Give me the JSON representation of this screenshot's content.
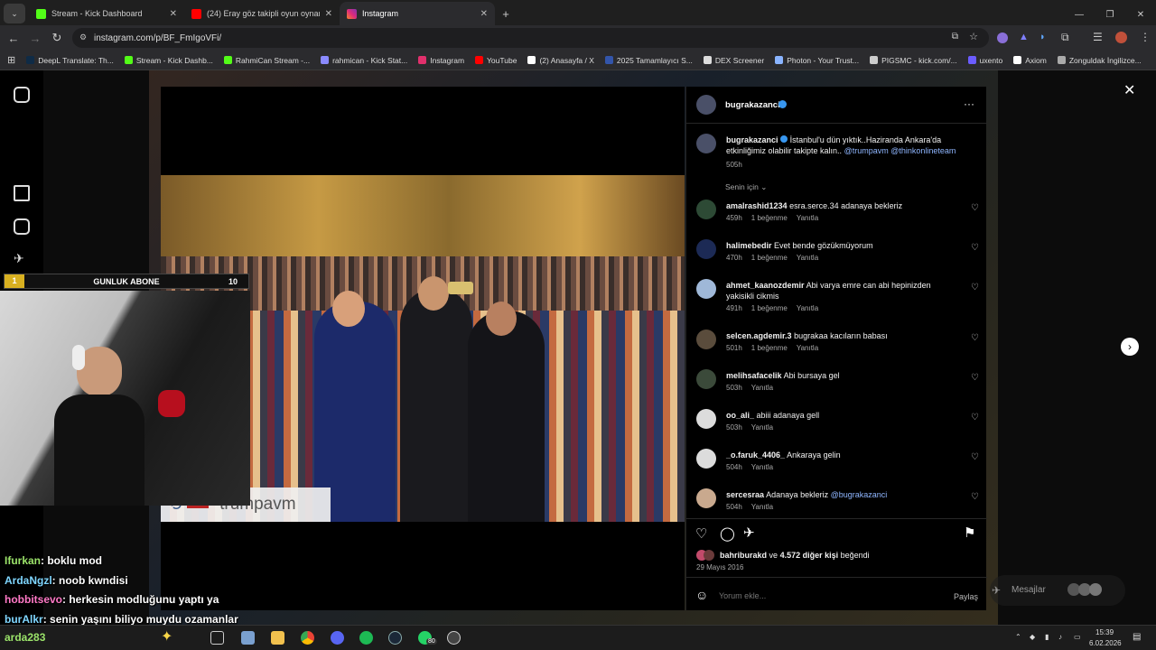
{
  "browser": {
    "tabs": [
      {
        "title": "Stream - Kick Dashboard",
        "active": false,
        "color": "#53fc18"
      },
      {
        "title": "(24) Eray göz takipli oyun oynar",
        "active": false,
        "color": "#ff0000"
      },
      {
        "title": "Instagram",
        "active": true,
        "color": "#e1306c"
      }
    ],
    "url": "instagram.com/p/BF_FmIgoVFi/",
    "bookmarks": [
      {
        "label": "DeepL Translate: Th...",
        "color": "#0f2b46"
      },
      {
        "label": "Stream - Kick Dashb...",
        "color": "#53fc18"
      },
      {
        "label": "RahmiCan Stream -...",
        "color": "#53fc18"
      },
      {
        "label": "rahmican - Kick Stat...",
        "color": "#8a8aff"
      },
      {
        "label": "Instagram",
        "color": "#e1306c"
      },
      {
        "label": "YouTube",
        "color": "#ff0000"
      },
      {
        "label": "(2) Anasayfa / X",
        "color": "#ffffff"
      },
      {
        "label": "2025 Tamamlayıcı S...",
        "color": "#3355aa"
      },
      {
        "label": "DEX Screener",
        "color": "#dddddd"
      },
      {
        "label": "Photon - Your Trust...",
        "color": "#8ab4ff"
      },
      {
        "label": "PIGSMC - kick.com/...",
        "color": "#cccccc"
      },
      {
        "label": "uxento",
        "color": "#6b5cff"
      },
      {
        "label": "Axiom",
        "color": "#ffffff"
      },
      {
        "label": "Zonguldak İngilizce...",
        "color": "#aaaaaa"
      }
    ]
  },
  "post": {
    "author": "bugrakazanci",
    "more": "···",
    "caption_user": "bugrakazanci",
    "caption": "İstanbul'u dün yıktık..Haziranda Ankara'da etkinliğimiz olabilir takipte kalın..",
    "caption_mentions": "@trumpavm @thinkonlineteam",
    "caption_time": "505h",
    "filter_label": "Senin için",
    "photo_watermark": "trumpavm",
    "likes_user": "bahriburakd",
    "likes_text_mid": "ve",
    "likes_count": "4.572 diğer kişi",
    "likes_suffix": "beğendi",
    "date": "29 Mayıs 2016",
    "comment_placeholder": "Yorum ekle...",
    "share_label": "Paylaş"
  },
  "comments": [
    {
      "user": "amalrashid1234",
      "text": "esra.serce.34 adanaya bekleriz",
      "time": "459h",
      "likes": "1 beğenme",
      "reply": "Yanıtla",
      "color": "#2d4a35"
    },
    {
      "user": "halimebedir",
      "text": "Evet bende gözükmüyorum",
      "time": "470h",
      "likes": "1 beğenme",
      "reply": "Yanıtla",
      "color": "#1c2a55"
    },
    {
      "user": "ahmet_kaanozdemir",
      "text": "Abi varya emre can abi hepinizden yakisikli cikmis",
      "time": "491h",
      "likes": "1 beğenme",
      "reply": "Yanıtla",
      "color": "#9fb8d8"
    },
    {
      "user": "selcen.agdemir.3",
      "text": "bugrakaa kacıların babası",
      "time": "501h",
      "likes": "1 beğenme",
      "reply": "Yanıtla",
      "color": "#5a4c3c"
    },
    {
      "user": "melihsafacelik",
      "text": "Abi bursaya gel",
      "time": "503h",
      "likes": "",
      "reply": "Yanıtla",
      "color": "#3b4a3a"
    },
    {
      "user": "oo_ali_",
      "text": "abiii adanaya gell",
      "time": "503h",
      "likes": "",
      "reply": "Yanıtla",
      "color": "#dcdcdc"
    },
    {
      "user": "_o.faruk_4406_",
      "text": "Ankaraya gelin",
      "time": "504h",
      "likes": "",
      "reply": "Yanıtla",
      "color": "#dcdcdc"
    },
    {
      "user": "sercesraa",
      "text": "Adanaya bekleriz",
      "mention": "@bugrakazanci",
      "time": "504h",
      "likes": "",
      "reply": "Yanıtla",
      "color": "#c9a98e"
    }
  ],
  "overlay": {
    "abone_num": "1",
    "abone_label": "GUNLUK ABONE",
    "abone_total": "10",
    "messages_label": "Mesajlar",
    "chat": [
      {
        "user": "Ifurkan",
        "text": ": boklu mod",
        "color": "#9be36a"
      },
      {
        "user": "ArdaNgzl",
        "text": ": noob kwndisi",
        "color": "#7fd6ff"
      },
      {
        "user": "hobbitsevo",
        "text": ": herkesin modluğunu yaptı ya",
        "color": "#ff79c6"
      },
      {
        "user": "burAlkr",
        "text": ": senin yaşını biliyo muydu ozamanlar",
        "color": "#7fd6ff"
      }
    ],
    "bottom_chat_user": "arda283"
  },
  "taskbar": {
    "time": "15:39",
    "date": "6.02.2026",
    "whatsapp_badge": "80"
  }
}
